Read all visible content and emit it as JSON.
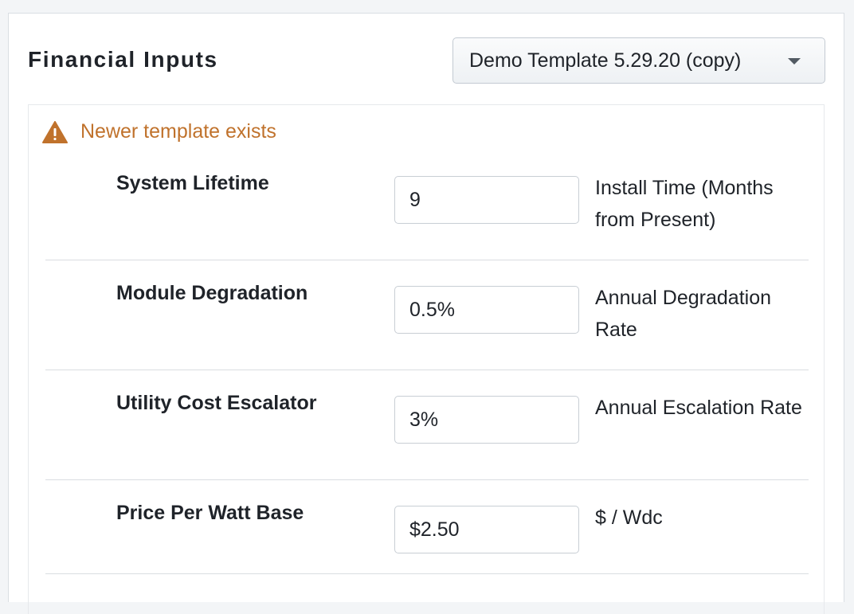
{
  "header": {
    "title": "Financial Inputs",
    "template_select": {
      "selected": "Demo Template 5.29.20 (copy)"
    }
  },
  "warning": {
    "text": "Newer template exists",
    "icon": "warning-triangle-icon",
    "color": "#c0722c"
  },
  "rows": [
    {
      "label": "System Lifetime",
      "value": "9",
      "desc": "Install Time (Months from Present)"
    },
    {
      "label": "Module Degradation",
      "value": "0.5%",
      "desc": "Annual Degradation Rate"
    },
    {
      "label": "Utility Cost Escalator",
      "value": "3%",
      "desc": "Annual Escalation Rate"
    },
    {
      "label": "Price Per Watt Base",
      "value": "$2.50",
      "desc": "$ / Wdc"
    }
  ]
}
